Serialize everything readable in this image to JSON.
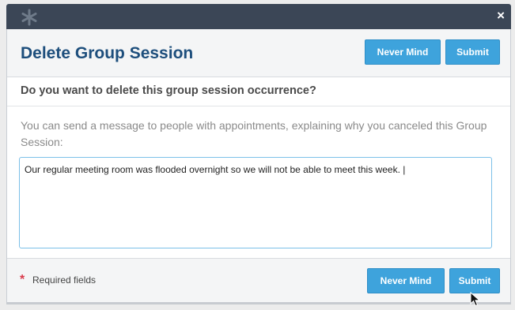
{
  "window": {
    "close_glyph": "×",
    "app_icon": "asterisk-logo-icon"
  },
  "dialog": {
    "title": "Delete Group Session",
    "header_buttons": {
      "never_mind": "Never Mind",
      "submit": "Submit"
    },
    "question": "Do you want to delete this group session occurrence?",
    "explanation": "You can send a message to people with appointments, explaining why you canceled this Group Session:",
    "message_value": "Our regular meeting room was flooded overnight so we will not be able to meet this week. |",
    "footer": {
      "required_star": "*",
      "required_label": "Required fields",
      "never_mind": "Never Mind",
      "submit": "Submit"
    }
  },
  "colors": {
    "title_text": "#1d4e7c",
    "button_bg": "#3ea3dc",
    "titlebar_bg": "#3b4656",
    "required_star": "#d9394a"
  }
}
